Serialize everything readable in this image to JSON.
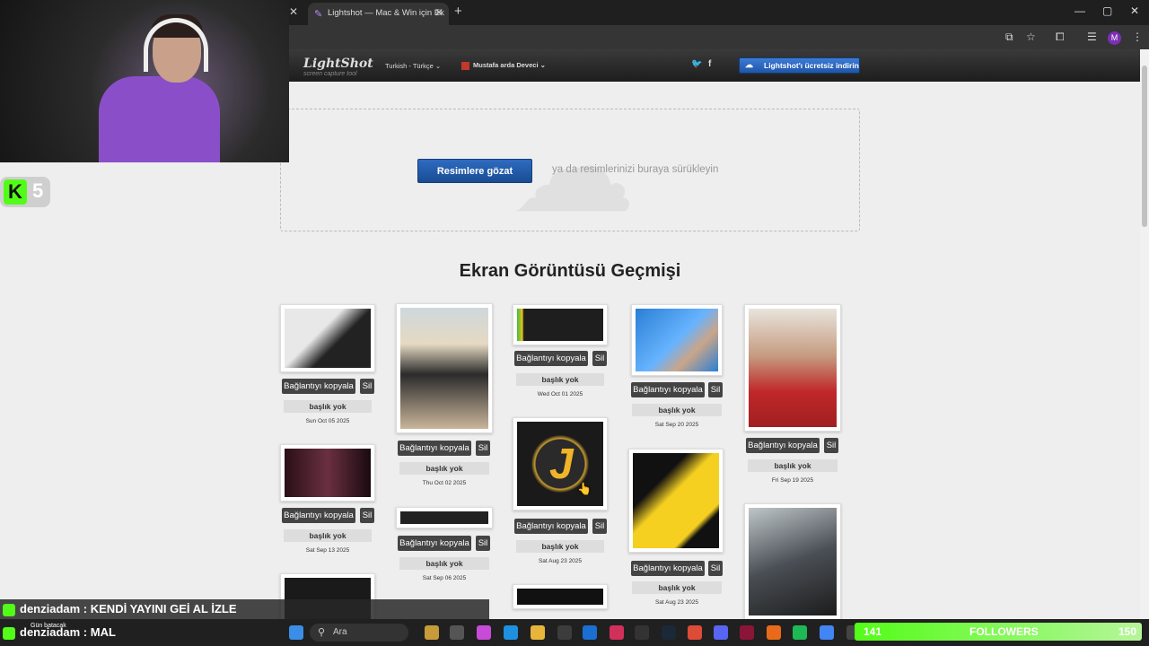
{
  "browser": {
    "tab_title": "Lightshot — Mac & Win için Ek",
    "close_glyph": "✕",
    "new_tab_glyph": "+",
    "window_controls": [
      "—",
      "▢",
      "✕"
    ],
    "profile_initial": "M"
  },
  "site": {
    "logo": "LightShot",
    "logo_sub": "screen capture tool",
    "language": "Turkish - Türkçe ⌄",
    "user": "Mustafa arda Deveci ⌄",
    "social": [
      "twitter-icon",
      "facebook-icon"
    ],
    "twitter_glyph": "🐦",
    "facebook_glyph": "f",
    "download_label": "Lightshot'ı ücretsiz indirin"
  },
  "upload": {
    "browse_label": "Resimlere gözat",
    "hint": "ya da resimlerinizi buraya sürükleyin"
  },
  "history": {
    "title": "Ekran Görüntüsü Geçmişi",
    "copy_label": "Bağlantıyı kopyala",
    "delete_label": "Sil",
    "no_title_label": "başlık yok",
    "dates": [
      "Sun Oct 05 2025",
      "Sat Sep 13 2025",
      "Thu Oct 02 2025",
      "Sat Sep 06 2025",
      "Wed Oct 01 2025",
      "Sat Aug 23 2025",
      "Sat Sep 20 2025",
      "Sat Aug 23 2025",
      "Fri Sep 19 2025"
    ]
  },
  "overlay": {
    "kick_count": "5",
    "kick_letter": "K",
    "chat_lines": [
      {
        "user": "denziadam",
        "message": "KENDİ YAYINI GEİ AL İZLE"
      },
      {
        "user": "denziadam",
        "message": "MAL"
      }
    ],
    "notification": "Gün batacak",
    "followers_count": "141",
    "followers_label": "FOLLOWERS",
    "followers_goal": "150"
  },
  "taskbar": {
    "search_placeholder": "Ara"
  },
  "colors": {
    "accent": "#1e56a8",
    "kick_green": "#53fc18",
    "page_bg": "#eeeeee"
  }
}
